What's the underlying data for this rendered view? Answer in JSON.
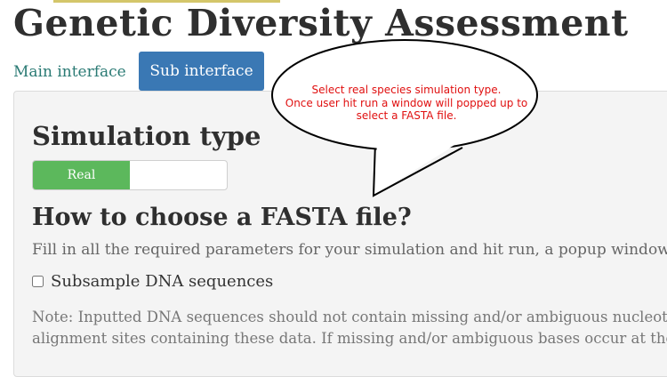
{
  "header": {
    "title": "Genetic Diversity Assessment"
  },
  "tabs": [
    {
      "label": "Main interface",
      "active": false
    },
    {
      "label": "Sub interface",
      "active": true
    }
  ],
  "panel": {
    "simulation_heading": "Simulation type",
    "toggle": {
      "on_label": "Real",
      "state": "on"
    },
    "fasta_heading": "How to choose a FASTA file?",
    "instructions": "Fill in all the required parameters for your simulation and hit run, a popup window will",
    "subsample": {
      "label": "Subsample DNA sequences",
      "checked": false
    },
    "note_line1": "Note: Inputted DNA sequences should not contain missing and/or ambiguous nucleoti",
    "note_line2": "alignment sites containing these data. If missing and/or ambiguous bases occur at the e"
  },
  "callout": {
    "line1": "Select real species simulation type.",
    "line2": "Once user hit run a window will popped up to",
    "line3": "select a FASTA file."
  },
  "colors": {
    "title": "#2f2f2f",
    "tab_active_bg": "#3a78b4",
    "tab_link": "#2a7a74",
    "toggle_on": "#5cb85c",
    "panel_bg": "#f4f4f4",
    "callout_text": "#e01010"
  }
}
